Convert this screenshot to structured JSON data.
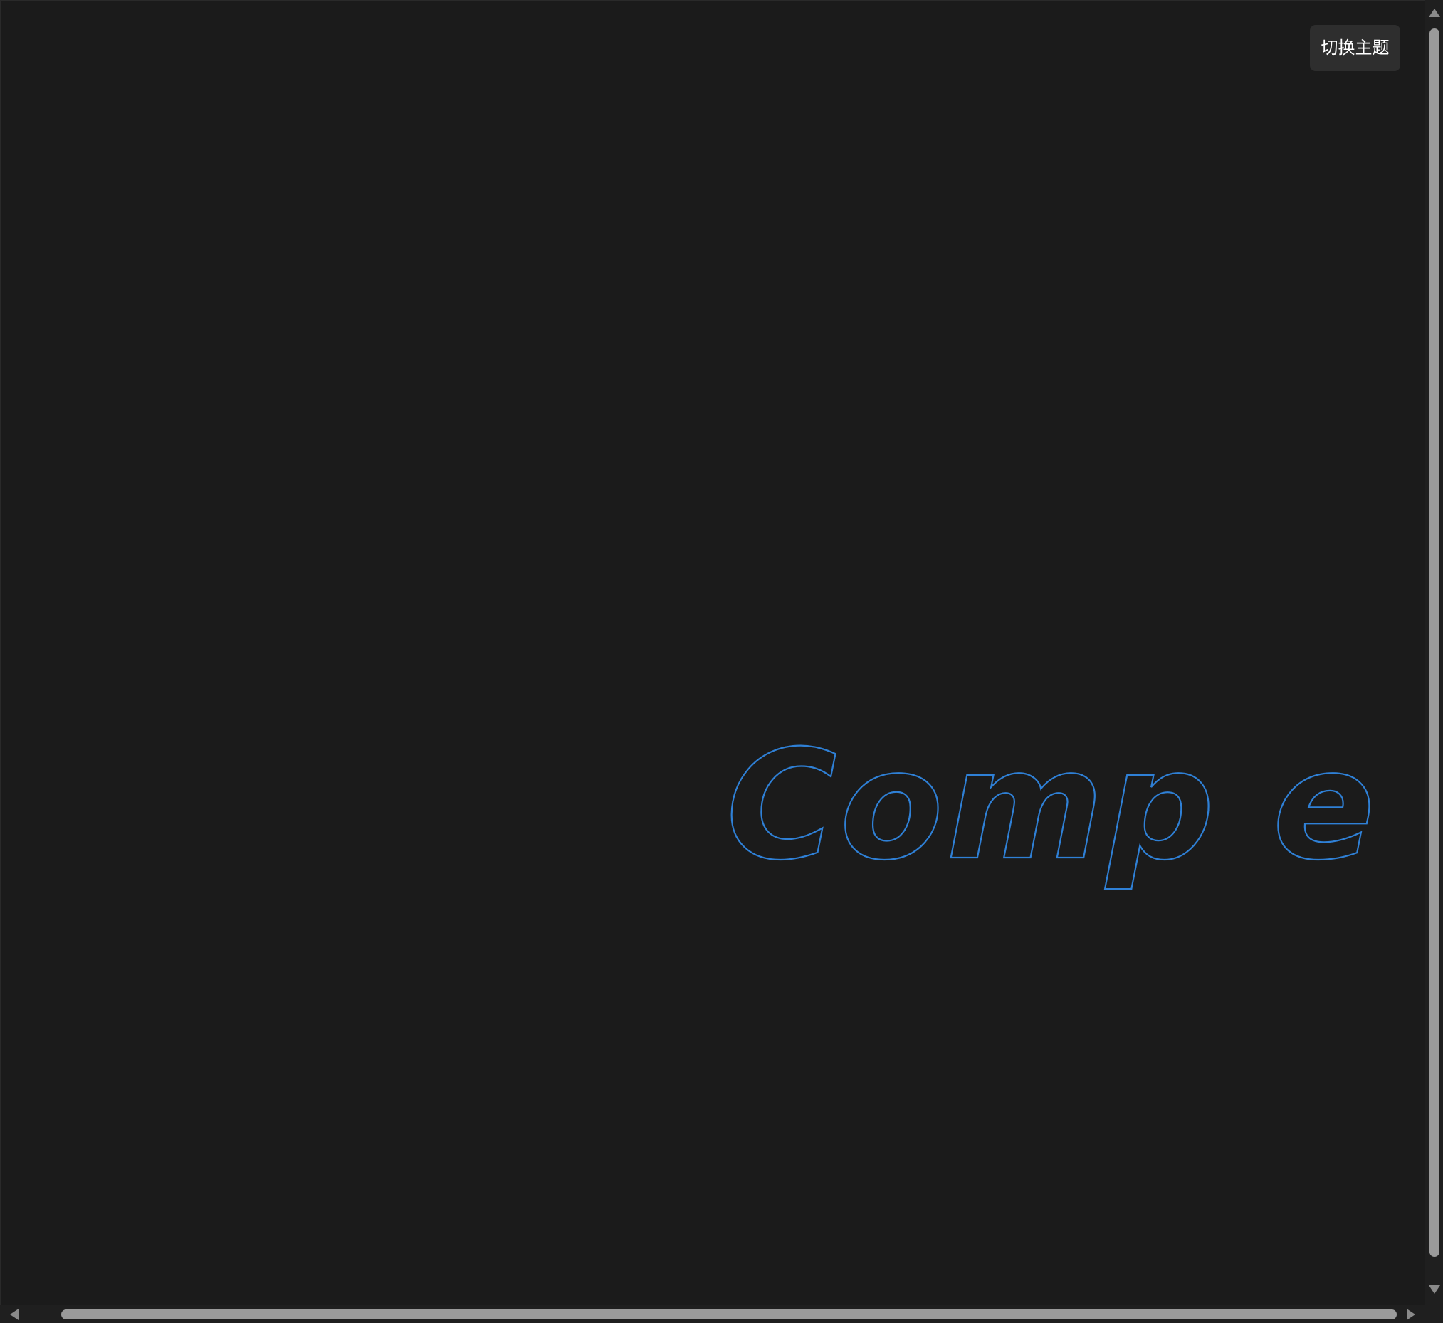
{
  "toolbar": {
    "theme_toggle_label": "切换主题"
  },
  "hero": {
    "outline_text": "Comp e",
    "stroke_color": "#2f80d6"
  },
  "colors": {
    "background": "#1b1b1b",
    "button_background": "#2e2e2e",
    "button_text": "#ffffff",
    "scrollbar_thumb": "#9a9a9a"
  }
}
